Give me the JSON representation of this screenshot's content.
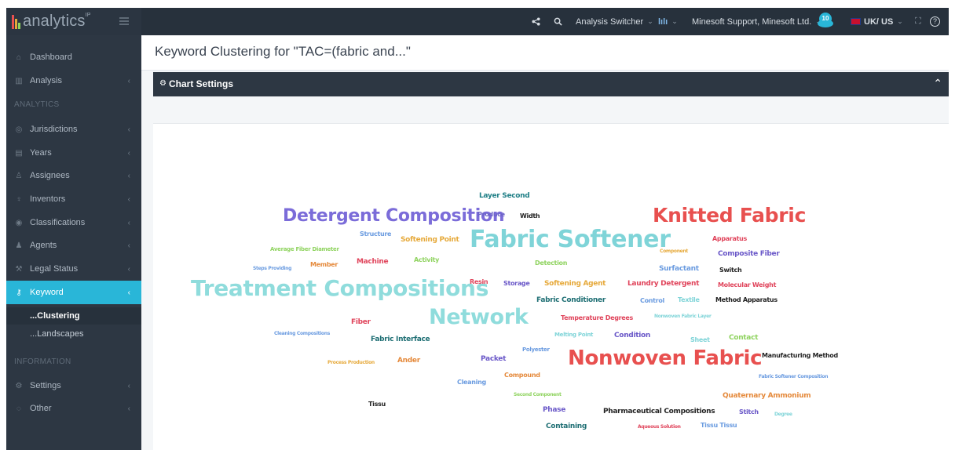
{
  "app": {
    "name": "analytics",
    "superscript": "IP"
  },
  "topbar": {
    "analysis_switcher": "Analysis Switcher",
    "chart_menu": "lılı",
    "account": "Minesoft Support, Minesoft Ltd.",
    "notifications": "10",
    "region": "UK/ US",
    "help": "?"
  },
  "sidebar": {
    "dashboard": "Dashboard",
    "analysis": "Analysis",
    "section_analytics": "ANALYTICS",
    "jurisdictions": "Jurisdictions",
    "years": "Years",
    "assignees": "Assignees",
    "inventors": "Inventors",
    "classifications": "Classifications",
    "agents": "Agents",
    "legal_status": "Legal Status",
    "keyword": "Keyword",
    "clustering": "...Clustering",
    "landscapes": "...Landscapes",
    "section_information": "INFORMATION",
    "settings": "Settings",
    "other": "Other"
  },
  "page": {
    "title": "Keyword Clustering for \"TAC=(fabric and...\"",
    "chart_settings": "Chart Settings"
  },
  "colors": {
    "accent": "#29b6d8",
    "sidebar": "#2d3743",
    "topbar": "#27313c"
  },
  "word_cloud": [
    {
      "text": "Layer Second",
      "color": "#1f7f86",
      "weight": 1
    },
    {
      "text": "Detergent Composition",
      "color": "#7b6cd9",
      "weight": 5
    },
    {
      "text": "Produce",
      "color": "#6c63c8",
      "weight": 1
    },
    {
      "text": "Width",
      "color": "#222222",
      "weight": 1
    },
    {
      "text": "Knitted Fabric",
      "color": "#e8504f",
      "weight": 6
    },
    {
      "text": "Structure",
      "color": "#6a9be0",
      "weight": 1
    },
    {
      "text": "Softening Point",
      "color": "#e6a93a",
      "weight": 1
    },
    {
      "text": "Fabric Softener",
      "color": "#7fd4d8",
      "weight": 7
    },
    {
      "text": "Apparatus",
      "color": "#e0445b",
      "weight": 1
    },
    {
      "text": "Average Fiber Diameter",
      "color": "#8fd35f",
      "weight": 1
    },
    {
      "text": "Component",
      "color": "#e6a93a",
      "weight": 1
    },
    {
      "text": "Composite Fiber",
      "color": "#6a58c8",
      "weight": 1
    },
    {
      "text": "Member",
      "color": "#e58a3c",
      "weight": 1
    },
    {
      "text": "Machine",
      "color": "#e0445b",
      "weight": 1
    },
    {
      "text": "Activity",
      "color": "#8fd35f",
      "weight": 1
    },
    {
      "text": "Steps Providing",
      "color": "#6a9be0",
      "weight": 1
    },
    {
      "text": "Detection",
      "color": "#8fd35f",
      "weight": 1
    },
    {
      "text": "Surfactant",
      "color": "#6a9be0",
      "weight": 1
    },
    {
      "text": "Switch",
      "color": "#222222",
      "weight": 1
    },
    {
      "text": "Treatment Compositions",
      "color": "#8fdcdc",
      "weight": 6
    },
    {
      "text": "Resin",
      "color": "#e0445b",
      "weight": 1
    },
    {
      "text": "Storage",
      "color": "#6a58c8",
      "weight": 1
    },
    {
      "text": "Softening Agent",
      "color": "#e6a93a",
      "weight": 1
    },
    {
      "text": "Laundry Detergent",
      "color": "#e0445b",
      "weight": 1
    },
    {
      "text": "Molecular Weight",
      "color": "#e0445b",
      "weight": 1
    },
    {
      "text": "Fabric Conditioner",
      "color": "#1f6f74",
      "weight": 1
    },
    {
      "text": "Control",
      "color": "#6a9be0",
      "weight": 1
    },
    {
      "text": "Textile",
      "color": "#7fd4d8",
      "weight": 1
    },
    {
      "text": "Method Apparatus",
      "color": "#222222",
      "weight": 1
    },
    {
      "text": "Network",
      "color": "#8fdcdc",
      "weight": 6
    },
    {
      "text": "Fiber",
      "color": "#e0445b",
      "weight": 1
    },
    {
      "text": "Temperature Degrees",
      "color": "#e0445b",
      "weight": 1
    },
    {
      "text": "Nonwoven Fabric Layer",
      "color": "#7fd4d8",
      "weight": 1
    },
    {
      "text": "Cleaning Compositions",
      "color": "#6a9be0",
      "weight": 1
    },
    {
      "text": "Melting Point",
      "color": "#7fd4d8",
      "weight": 1
    },
    {
      "text": "Condition",
      "color": "#6a58c8",
      "weight": 1
    },
    {
      "text": "Sheet",
      "color": "#7fd4d8",
      "weight": 1
    },
    {
      "text": "Contact",
      "color": "#8fd35f",
      "weight": 1
    },
    {
      "text": "Fabric Interface",
      "color": "#1f6f74",
      "weight": 1
    },
    {
      "text": "Polyester",
      "color": "#6a9be0",
      "weight": 1
    },
    {
      "text": "Manufacturing Method",
      "color": "#222222",
      "weight": 1
    },
    {
      "text": "Process Production",
      "color": "#e6a93a",
      "weight": 1
    },
    {
      "text": "Ander",
      "color": "#e58a3c",
      "weight": 1
    },
    {
      "text": "Packet",
      "color": "#6a58c8",
      "weight": 1
    },
    {
      "text": "Nonwoven Fabric",
      "color": "#e8504f",
      "weight": 5
    },
    {
      "text": "Compound",
      "color": "#e58a3c",
      "weight": 1
    },
    {
      "text": "Fabric Softener Composition",
      "color": "#6a9be0",
      "weight": 1
    },
    {
      "text": "Cleaning",
      "color": "#6a9be0",
      "weight": 1
    },
    {
      "text": "Second Component",
      "color": "#8fd35f",
      "weight": 1
    },
    {
      "text": "Quaternary Ammonium",
      "color": "#e58a3c",
      "weight": 1
    },
    {
      "text": "Tissu",
      "color": "#222222",
      "weight": 1
    },
    {
      "text": "Phase",
      "color": "#6a58c8",
      "weight": 1
    },
    {
      "text": "Pharmaceutical Compositions",
      "color": "#222222",
      "weight": 1
    },
    {
      "text": "Stitch",
      "color": "#6a58c8",
      "weight": 1
    },
    {
      "text": "Degree",
      "color": "#7fd4d8",
      "weight": 1
    },
    {
      "text": "Containing",
      "color": "#1f6f74",
      "weight": 1
    },
    {
      "text": "Aqueous Solution",
      "color": "#e0445b",
      "weight": 1
    },
    {
      "text": "Tissu Tissu",
      "color": "#6a9be0",
      "weight": 1
    }
  ]
}
